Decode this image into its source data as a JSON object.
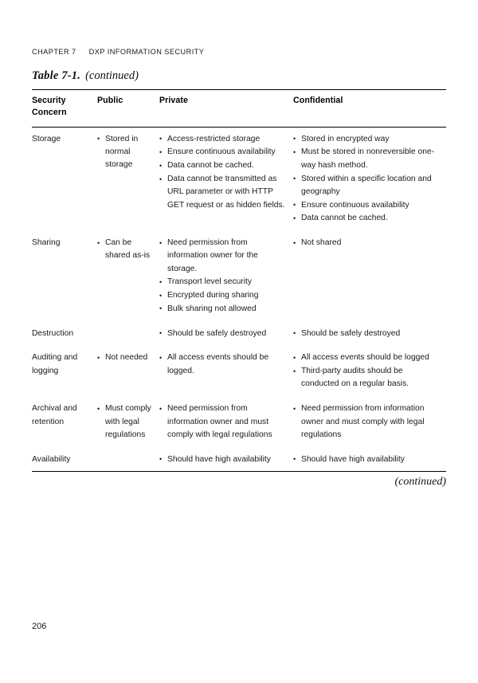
{
  "running_head": {
    "chapter": "CHAPTER 7",
    "title": "DXP INFORMATION SECURITY"
  },
  "caption": {
    "label": "Table 7-1.",
    "continued": "(continued)"
  },
  "table": {
    "headers": {
      "concern_line1": "Security",
      "concern_line2": "Concern",
      "public": "Public",
      "private": "Private",
      "confidential": "Confidential"
    },
    "rows": [
      {
        "concern": "Storage",
        "public": [
          "Stored in normal storage"
        ],
        "private": [
          "Access-restricted storage",
          "Ensure continuous availability",
          "Data cannot be cached.",
          "Data cannot be transmitted as URL parameter or with HTTP GET request or as hidden fields."
        ],
        "confidential": [
          "Stored in encrypted way",
          "Must be stored in nonreversible one-way hash method.",
          "Stored within a specific location and geography",
          "Ensure continuous availability",
          "Data cannot be cached."
        ]
      },
      {
        "concern": "Sharing",
        "public": [
          "Can be shared as-is"
        ],
        "private": [
          "Need permission from information owner for the storage.",
          "Transport level security",
          "Encrypted during sharing",
          "Bulk sharing not allowed"
        ],
        "confidential": [
          "Not shared"
        ]
      },
      {
        "concern": "Destruction",
        "public": [],
        "private": [
          "Should be safely destroyed"
        ],
        "confidential": [
          "Should be safely destroyed"
        ]
      },
      {
        "concern": "Auditing and logging",
        "public": [
          "Not needed"
        ],
        "private": [
          "All access events should be logged."
        ],
        "confidential": [
          "All access events should be logged",
          "Third-party audits should be conducted on a regular basis."
        ]
      },
      {
        "concern": "Archival and retention",
        "public": [
          "Must comply with legal regulations"
        ],
        "private": [
          "Need permission from information owner and must comply with legal regulations"
        ],
        "confidential": [
          "Need permission from information owner and must comply with legal regulations"
        ]
      },
      {
        "concern": "Availability",
        "public": [],
        "private": [
          "Should have high availability"
        ],
        "confidential": [
          "Should have high availability"
        ]
      }
    ],
    "continued_note": "(continued)"
  },
  "folio": "206"
}
